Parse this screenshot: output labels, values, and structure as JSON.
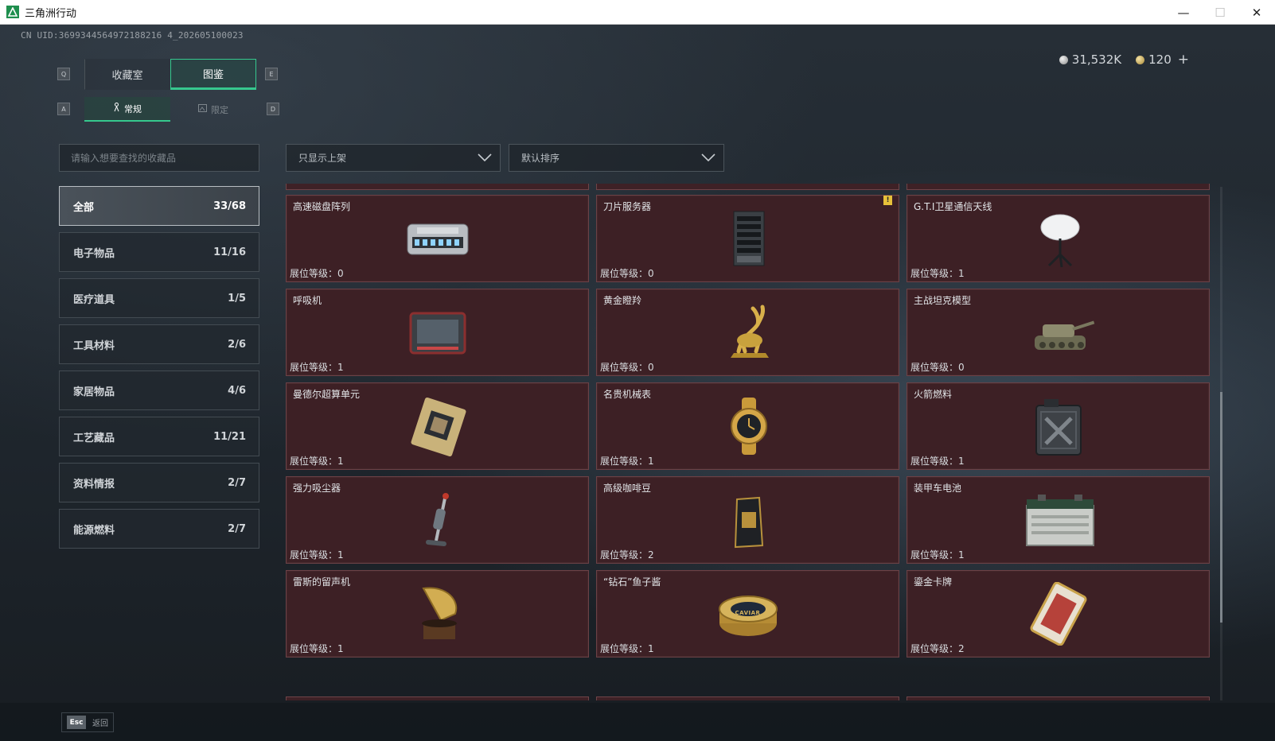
{
  "window": {
    "title": "三角洲行动",
    "minimize": "—",
    "maximize": "☐",
    "close": "✕"
  },
  "uid": "CN UID:3699344564972188216 4_202605100023",
  "currency": {
    "silver": "31,532K",
    "gold": "120",
    "plus": "+"
  },
  "keys": {
    "left": "Q",
    "right": "E",
    "sub_left": "A",
    "sub_right": "D"
  },
  "tabs": [
    {
      "label": "收藏室",
      "active": false
    },
    {
      "label": "图鉴",
      "active": true
    }
  ],
  "subtabs": [
    {
      "label": "常规",
      "icon": "figure-icon",
      "active": true
    },
    {
      "label": "限定",
      "icon": "frame-icon",
      "active": false
    }
  ],
  "search": {
    "placeholder": "请输入想要查找的收藏品",
    "value": ""
  },
  "categories": [
    {
      "label": "全部",
      "count": "33/68",
      "active": true
    },
    {
      "label": "电子物品",
      "count": "11/16"
    },
    {
      "label": "医疗道具",
      "count": "1/5"
    },
    {
      "label": "工具材料",
      "count": "2/6"
    },
    {
      "label": "家居物品",
      "count": "4/6"
    },
    {
      "label": "工艺藏品",
      "count": "11/21"
    },
    {
      "label": "资料情报",
      "count": "2/7"
    },
    {
      "label": "能源燃料",
      "count": "2/7"
    }
  ],
  "filters": {
    "shelf": "只显示上架",
    "sort": "默认排序"
  },
  "level_label": "展位等级：",
  "items": [
    {
      "name": "高速磁盘阵列",
      "level": "0",
      "icon": "disk-array-icon",
      "warn": false
    },
    {
      "name": "刀片服务器",
      "level": "0",
      "icon": "blade-server-icon",
      "warn": true
    },
    {
      "name": "G.T.I卫星通信天线",
      "level": "1",
      "icon": "satellite-antenna-icon",
      "warn": false
    },
    {
      "name": "呼吸机",
      "level": "1",
      "icon": "ventilator-icon",
      "warn": false
    },
    {
      "name": "黄金瞪羚",
      "level": "0",
      "icon": "golden-gazelle-icon",
      "warn": false
    },
    {
      "name": "主战坦克模型",
      "level": "0",
      "icon": "tank-model-icon",
      "warn": false
    },
    {
      "name": "曼德尔超算单元",
      "level": "1",
      "icon": "supercomputer-unit-icon",
      "warn": false
    },
    {
      "name": "名贵机械表",
      "level": "1",
      "icon": "watch-icon",
      "warn": false
    },
    {
      "name": "火箭燃料",
      "level": "1",
      "icon": "rocket-fuel-icon",
      "warn": false
    },
    {
      "name": "强力吸尘器",
      "level": "1",
      "icon": "vacuum-icon",
      "warn": false
    },
    {
      "name": "高级咖啡豆",
      "level": "2",
      "icon": "coffee-bag-icon",
      "warn": false
    },
    {
      "name": "装甲车电池",
      "level": "1",
      "icon": "battery-icon",
      "warn": false
    },
    {
      "name": "雷斯的留声机",
      "level": "1",
      "icon": "gramophone-icon",
      "warn": false
    },
    {
      "name": "“钻石”鱼子酱",
      "level": "1",
      "icon": "caviar-tin-icon",
      "warn": false
    },
    {
      "name": "鎏金卡牌",
      "level": "2",
      "icon": "gilded-card-icon",
      "warn": false
    }
  ],
  "warn_glyph": "!",
  "caviar_text": "CAVIAR",
  "bottom": {
    "esc_key": "Esc",
    "esc_label": "返回"
  },
  "colors": {
    "accent": "#36c88e",
    "card_bg": "#3d2025",
    "card_border": "#6c4146"
  }
}
